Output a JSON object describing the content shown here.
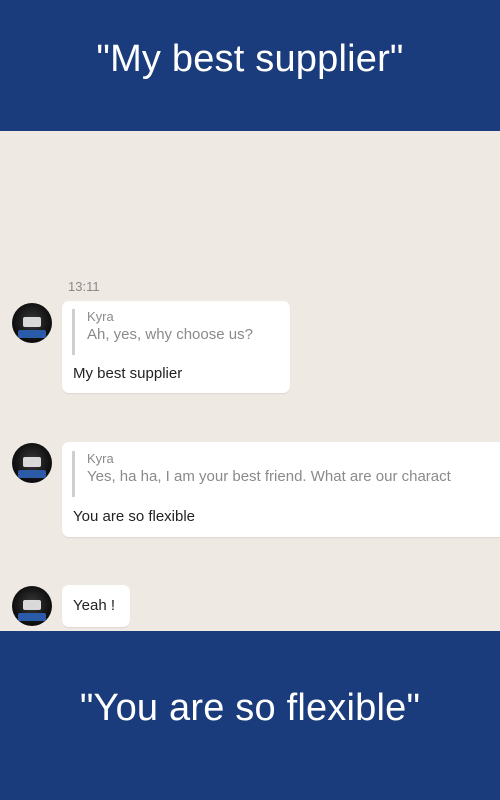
{
  "top_banner": {
    "text": "\"My best supplier\""
  },
  "bottom_banner": {
    "text": "\"You are so flexible\""
  },
  "colors": {
    "banner": "#1b3c7c",
    "chat_background": "#efe9e3",
    "bubble": "#ffffff",
    "muted_text": "#8a8a8a"
  },
  "chat": {
    "timestamp": "13:11",
    "messages": [
      {
        "avatar_icon": "user-avatar-icon",
        "quote": {
          "name": "Kyra",
          "text": "Ah, yes, why choose us?"
        },
        "text": "My best supplier"
      },
      {
        "avatar_icon": "user-avatar-icon",
        "quote": {
          "name": "Kyra",
          "text": "Yes, ha ha, I am your best friend. What are our charact"
        },
        "text": "You are so flexible"
      },
      {
        "avatar_icon": "user-avatar-icon",
        "text": "Yeah !"
      }
    ]
  }
}
